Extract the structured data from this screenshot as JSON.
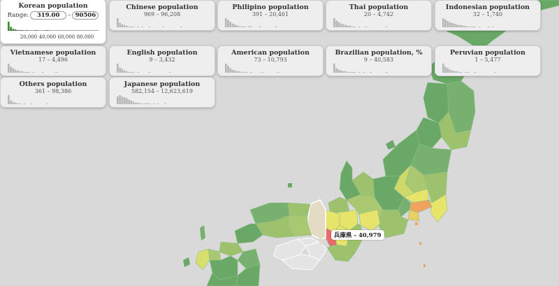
{
  "cards": [
    {
      "id": "korean",
      "title": "Korean population",
      "range": "",
      "active": true,
      "range_label": "Range:",
      "min_value": "319.00",
      "max_value": "90506",
      "separator": "–",
      "hist": [
        14,
        6,
        3,
        2,
        1,
        1,
        1,
        0,
        1,
        0,
        0,
        0,
        1,
        0,
        0,
        0,
        0,
        1
      ],
      "axis_ticks": [
        "20,000",
        "40,000",
        "60,000",
        "80,000"
      ]
    },
    {
      "id": "chinese",
      "title": "Chinese population",
      "range": "969 – 96,208",
      "hist": [
        12,
        6,
        4,
        3,
        2,
        1,
        1,
        1,
        0,
        1,
        0,
        1,
        0,
        0,
        1,
        0,
        0,
        0,
        0,
        0,
        1,
        0,
        0,
        0,
        0,
        0,
        0,
        0,
        1
      ]
    },
    {
      "id": "philipino",
      "title": "Philipino population",
      "range": "391 – 20,461",
      "hist": [
        10,
        8,
        6,
        4,
        3,
        2,
        1,
        1,
        1,
        0,
        1,
        1,
        0,
        0,
        0,
        1,
        0,
        0,
        0,
        0,
        0,
        0,
        1
      ]
    },
    {
      "id": "thai",
      "title": "Thai population",
      "range": "20 – 4,742",
      "hist": [
        12,
        9,
        7,
        5,
        4,
        3,
        2,
        2,
        1,
        1,
        0,
        1,
        0,
        0,
        1,
        0,
        0,
        0,
        0,
        0,
        0,
        0,
        0,
        1
      ]
    },
    {
      "id": "indonesian",
      "title": "Indonesian population",
      "range": "32 – 1,740",
      "hist": [
        13,
        11,
        9,
        7,
        6,
        5,
        4,
        3,
        3,
        2,
        2,
        1,
        1,
        1,
        1,
        0,
        1,
        0,
        0,
        0,
        1,
        0,
        1
      ]
    },
    {
      "id": "vietnamese",
      "title": "Vietnamese population",
      "range": "17 – 4,496",
      "hist": [
        12,
        8,
        6,
        4,
        3,
        2,
        2,
        1,
        1,
        1,
        0,
        1,
        0,
        0,
        0,
        1,
        0,
        0,
        0,
        0,
        0,
        1
      ]
    },
    {
      "id": "english",
      "title": "English population",
      "range": "9 – 3,432",
      "hist": [
        12,
        7,
        5,
        3,
        2,
        1,
        1,
        1,
        0,
        1,
        0,
        0,
        0,
        0,
        1,
        0,
        0,
        0,
        0,
        0,
        0,
        0,
        0,
        1
      ]
    },
    {
      "id": "american",
      "title": "American population",
      "range": "73 – 10,793",
      "hist": [
        12,
        9,
        6,
        4,
        3,
        2,
        2,
        1,
        1,
        1,
        0,
        1,
        0,
        0,
        0,
        0,
        1,
        0,
        0,
        0,
        0,
        0,
        0,
        1
      ]
    },
    {
      "id": "brazilian",
      "title": "Brazilian population, %",
      "range": "9 – 40,583",
      "hist": [
        12,
        6,
        4,
        3,
        2,
        2,
        1,
        1,
        1,
        1,
        0,
        1,
        0,
        1,
        0,
        0,
        1,
        0,
        0,
        0,
        0,
        0,
        0,
        1
      ]
    },
    {
      "id": "peruvian",
      "title": "Peruvian population",
      "range": "1 – 5,477",
      "hist": [
        12,
        8,
        6,
        4,
        3,
        2,
        2,
        1,
        1,
        0,
        1,
        1,
        0,
        0,
        1,
        0,
        0,
        0,
        0,
        0,
        0,
        0,
        0,
        1
      ]
    },
    {
      "id": "others",
      "title": "Others population",
      "range": "361 – 98,386",
      "hist": [
        12,
        5,
        3,
        2,
        1,
        1,
        0,
        1,
        0,
        0,
        1,
        0,
        0,
        0,
        0,
        0,
        0,
        1
      ]
    },
    {
      "id": "japanese",
      "title": "Japanese population",
      "range": "582,154 – 12,623,619",
      "hist": [
        10,
        12,
        10,
        9,
        8,
        6,
        5,
        3,
        2,
        2,
        1,
        1,
        1,
        1,
        1,
        0,
        1,
        0,
        1,
        0,
        0,
        1
      ]
    }
  ],
  "tooltip": {
    "prefecture": "兵庫県",
    "value": "40,979"
  },
  "colors": {
    "background": "#d9d9d9",
    "low": "#6aa867",
    "mid": "#a9c871",
    "yellow": "#e6e46a",
    "orange": "#f0a35e",
    "red": "#e86b6b",
    "selected": "#e4dbc4",
    "hist_bar": "#b7b7b7",
    "hist_bar_active": "#3d8c35"
  }
}
